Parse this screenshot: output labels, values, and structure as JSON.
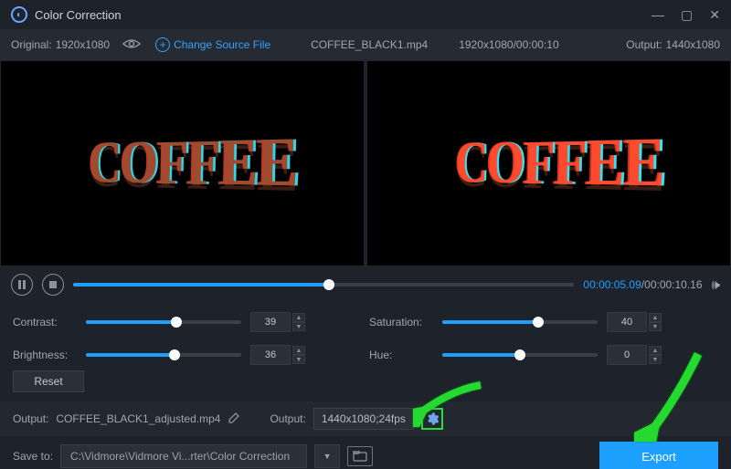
{
  "title": "Color Correction",
  "header": {
    "original_label": "Original:",
    "original_res": "1920x1080",
    "change_label": "Change Source File",
    "filename": "COFFEE_BLACK1.mp4",
    "src_info": "1920x1080/00:00:10",
    "output_label": "Output:",
    "output_res": "1440x1080"
  },
  "preview_text": "COFFEE",
  "play": {
    "current": "00:00:05.09",
    "total": "00:00:10.16",
    "progress_pct": 51
  },
  "adjust": {
    "contrast": {
      "label": "Contrast:",
      "value": "39",
      "pct": 58
    },
    "brightness": {
      "label": "Brightness:",
      "value": "36",
      "pct": 57
    },
    "saturation": {
      "label": "Saturation:",
      "value": "40",
      "pct": 62
    },
    "hue": {
      "label": "Hue:",
      "value": "0",
      "pct": 50
    }
  },
  "reset_label": "Reset",
  "out": {
    "file_label": "Output:",
    "file_name": "COFFEE_BLACK1_adjusted.mp4",
    "fmt_label": "Output:",
    "fmt_value": "1440x1080;24fps"
  },
  "save": {
    "label": "Save to:",
    "path": "C:\\Vidmore\\Vidmore Vi...rter\\Color Correction"
  },
  "export_label": "Export"
}
